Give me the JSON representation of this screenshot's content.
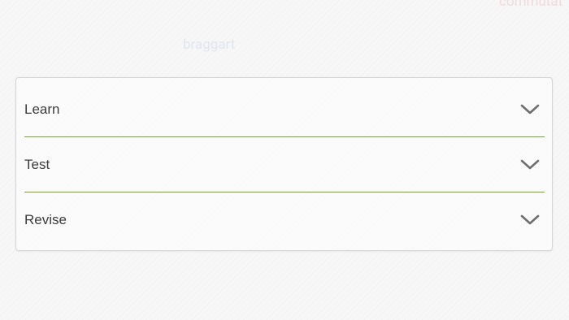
{
  "background_words": [
    "commutat",
    "braggart"
  ],
  "accordion": {
    "items": [
      {
        "label": "Learn",
        "icon": "chevron-down-icon"
      },
      {
        "label": "Test",
        "icon": "chevron-down-icon"
      },
      {
        "label": "Revise",
        "icon": "chevron-down-icon"
      }
    ]
  },
  "colors": {
    "divider": "#7a9a58",
    "chevron": "#6e6e6e",
    "label": "#3c3c3c"
  }
}
